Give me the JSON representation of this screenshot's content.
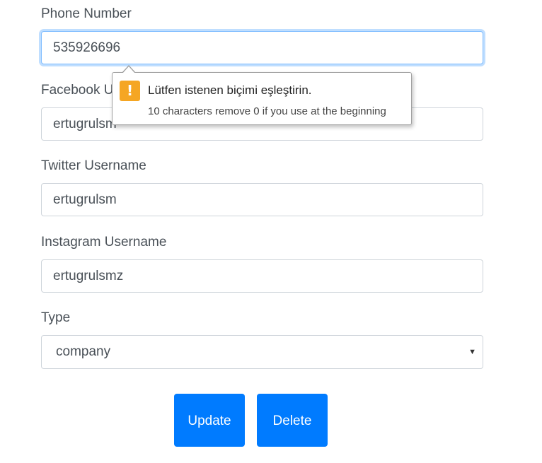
{
  "form": {
    "phone": {
      "label": "Phone Number",
      "value": "535926696"
    },
    "facebook": {
      "label": "Facebook Username",
      "value": "ertugrulsm"
    },
    "twitter": {
      "label": "Twitter Username",
      "value": "ertugrulsm"
    },
    "instagram": {
      "label": "Instagram Username",
      "value": "ertugrulsmz"
    },
    "type": {
      "label": "Type",
      "selected": "company"
    }
  },
  "buttons": {
    "update": "Update",
    "delete": "Delete"
  },
  "validation": {
    "title": "Lütfen istenen biçimi eşleştirin.",
    "message": "10 characters remove 0 if you use at the beginning",
    "icon": "warning-icon",
    "icon_color": "#f5a623"
  },
  "colors": {
    "primary": "#007bff",
    "focus": "#80bdff"
  }
}
